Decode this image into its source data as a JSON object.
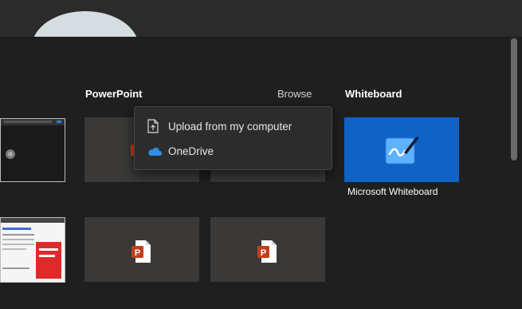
{
  "sections": {
    "powerpoint_title": "PowerPoint",
    "browse_label": "Browse",
    "whiteboard_title": "Whiteboard"
  },
  "browse_menu": {
    "items": [
      {
        "label": "Upload from my computer",
        "icon": "file-upload-icon"
      },
      {
        "label": "OneDrive",
        "icon": "onedrive-cloud-icon"
      }
    ]
  },
  "whiteboard": {
    "tile_label": "Microsoft Whiteboard",
    "tile_color": "#0f62c6"
  },
  "powerpoint": {
    "accent_color": "#c43e1c"
  }
}
